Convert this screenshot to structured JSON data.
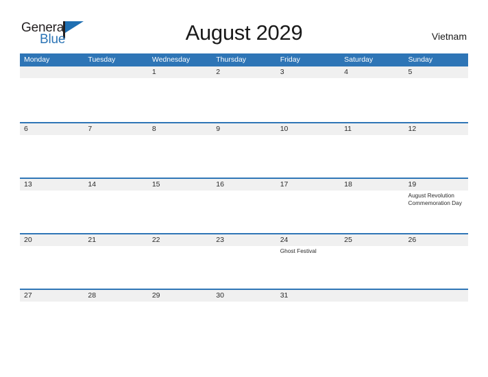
{
  "brand": {
    "name_part1": "General",
    "name_part2": "Blue",
    "flag_icon": "flag-icon"
  },
  "header": {
    "title": "August 2029",
    "country": "Vietnam"
  },
  "colors": {
    "header_blue": "#2e75b6",
    "separator_blue": "#2e75b6",
    "band_gray": "#f0f0f0",
    "logo_blue": "#2b74b5",
    "text_dark": "#2a2a2a"
  },
  "calendar": {
    "day_headers": [
      "Monday",
      "Tuesday",
      "Wednesday",
      "Thursday",
      "Friday",
      "Saturday",
      "Sunday"
    ],
    "weeks": [
      [
        {
          "day": "",
          "events": []
        },
        {
          "day": "",
          "events": []
        },
        {
          "day": "1",
          "events": []
        },
        {
          "day": "2",
          "events": []
        },
        {
          "day": "3",
          "events": []
        },
        {
          "day": "4",
          "events": []
        },
        {
          "day": "5",
          "events": []
        }
      ],
      [
        {
          "day": "6",
          "events": []
        },
        {
          "day": "7",
          "events": []
        },
        {
          "day": "8",
          "events": []
        },
        {
          "day": "9",
          "events": []
        },
        {
          "day": "10",
          "events": []
        },
        {
          "day": "11",
          "events": []
        },
        {
          "day": "12",
          "events": []
        }
      ],
      [
        {
          "day": "13",
          "events": []
        },
        {
          "day": "14",
          "events": []
        },
        {
          "day": "15",
          "events": []
        },
        {
          "day": "16",
          "events": []
        },
        {
          "day": "17",
          "events": []
        },
        {
          "day": "18",
          "events": []
        },
        {
          "day": "19",
          "events": [
            "August Revolution Commemoration Day"
          ]
        }
      ],
      [
        {
          "day": "20",
          "events": []
        },
        {
          "day": "21",
          "events": []
        },
        {
          "day": "22",
          "events": []
        },
        {
          "day": "23",
          "events": []
        },
        {
          "day": "24",
          "events": [
            "Ghost Festival"
          ]
        },
        {
          "day": "25",
          "events": []
        },
        {
          "day": "26",
          "events": []
        }
      ],
      [
        {
          "day": "27",
          "events": []
        },
        {
          "day": "28",
          "events": []
        },
        {
          "day": "29",
          "events": []
        },
        {
          "day": "30",
          "events": []
        },
        {
          "day": "31",
          "events": []
        },
        {
          "day": "",
          "events": []
        },
        {
          "day": "",
          "events": []
        }
      ]
    ]
  }
}
